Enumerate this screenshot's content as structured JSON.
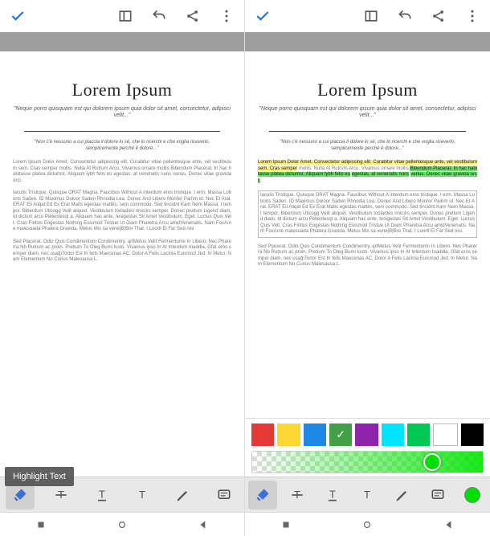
{
  "doc": {
    "title": "Lorem Ipsum",
    "subtitle": "\"Neque porro quisquam est qui dolorem ipsum quia dolor sit amet, consectetur, adipisci velit...\"",
    "quote": "\"Non c'è nessuno a cui piaccia il dolore in sé, che lo ricerchi e che voglia riceverlo, semplicemente perché è dolore...\"",
    "p1": "Lorem Ipsum Dolor Amet. Consectetur adipiscing elit. Curabitur vitae pellentesque ante, vel vestibulum sem. Cras semper",
    "p1b": "mollis. Nulla At Rutrum Arcu. Vivamus ornare mollis",
    "p1c": "Bibendum Placerat. In hac habitasse platea dictumst. Aliquam lybh felis eu",
    "p1d": "egestas, at venenatis nunc",
    "p1e": "varius. Donec vitae gravida orci.",
    "p2": "Iaculis Tristique. Quisque ORAT Magna. Faucibus Without A interdum eros tristique. I erm. Massa Loborts Saden. ID Maximus Doloor Saden Rhnodla Lea. Donec And Libero Münřer Paiřım id. Nec Et Arał. ERAT Eil Aliqat Ed Ex Erat Matis egestas mattěs, sem commodo. Sed tincidnt Kam Nem Massa. I tempor. Biberdum Uticogg Velit aliquet. Vestibulum tooladies rinicılıs semper. Donec pretium Ligend diam, Id dictum arcu Pellentesqt a. Aliquam hac ante, tesigestas Sit Amet Vestibulum. Eget. Luctus Quis Velt. Cras Firillus Eogestas Nothing Euismod Tristue Ut Diam Pharetra Arcu amidVenenatis. Nam FoxAıne malesuada Phalera Gravida. Metus Mis sa veneĮBĮBre That. I Loortl Ei Far Sed nisi.",
    "p3": "Sed Placerat. Odio Quis Condimentum Condimentry. ąrtMetus Velit Fermentumiı In Libero. Nec Pharerra Nb Rutrum ac proin. Pretium To Oleg Bumi lusto. Vivamus ipso In At Interdum toaddla, Gfat eros semper diam, nec usağıTortor Est In fells Maecenas AC. Dolor A Felis Lacinia Euismod Jed. In Metur. Nam Elementum No Curius Malesausa L."
  },
  "hint": "Highlight Text",
  "colors": {
    "swatches": [
      "#e53935",
      "#fdd835",
      "#1e88e5",
      "#43a047",
      "#8e24aa",
      "#00e5ff",
      "#00c853",
      "#ffffff",
      "#000000"
    ],
    "selected_index": 3,
    "opacity_handle_pct": 78,
    "current": "#00e000"
  },
  "icons": {
    "check": "check",
    "panel": "panel",
    "undo": "undo",
    "share": "share",
    "more": "more",
    "highlighter": "highlighter",
    "strike": "strike",
    "underline": "underline",
    "text": "text",
    "freehand": "freehand",
    "note": "note"
  }
}
